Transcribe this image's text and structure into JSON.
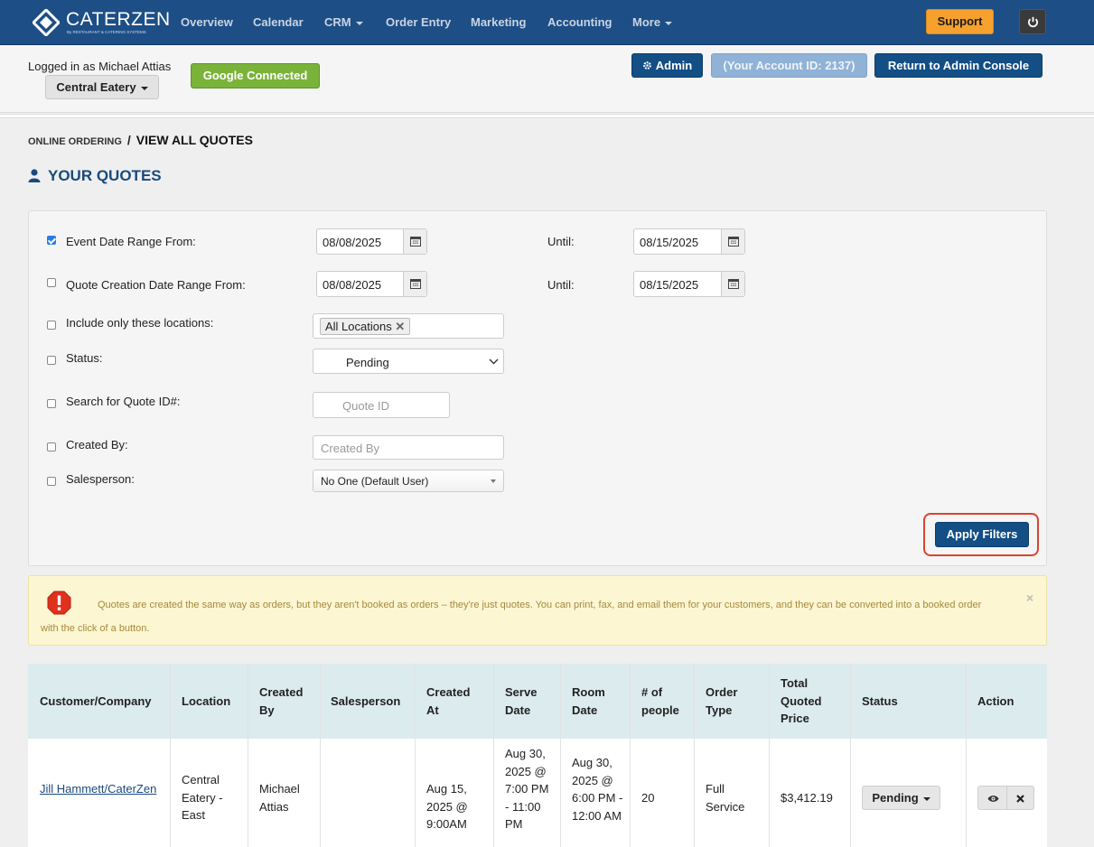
{
  "app": {
    "brand": "CATERZEN",
    "tagline": "By RESTAURANT & CATERING SYSTEMS",
    "colors": {
      "navbar": "#1d4e86",
      "support": "#f6a12e",
      "primary_button": "#134e85",
      "google": "#7bb33a",
      "alert_bg": "#fcf6d2",
      "table_header": "#dcebee"
    }
  },
  "nav": {
    "items": [
      "Overview",
      "Calendar",
      "CRM",
      "Order Entry",
      "Marketing",
      "Accounting",
      "More"
    ],
    "support_label": "Support",
    "power_icon": "power-icon"
  },
  "account": {
    "logged_in": "Logged in as Michael Attias",
    "location": "Central Eatery",
    "google": "Google Connected",
    "admin": "Admin",
    "account_id": "(Your Account ID: 2137)",
    "return": "Return to Admin Console"
  },
  "breadcrumb": {
    "parent": "ONLINE ORDERING",
    "separator": "/",
    "current": "VIEW ALL QUOTES"
  },
  "page_title": "YOUR QUOTES",
  "filters": {
    "event_date": {
      "label": "Event Date Range From:",
      "checked": true,
      "from": "08/08/2025",
      "until_label": "Until:",
      "until": "08/15/2025"
    },
    "quote_creation": {
      "label": "Quote Creation Date Range From:",
      "checked": false,
      "from": "08/08/2025",
      "until_label": "Until:",
      "until": "08/15/2025"
    },
    "locations": {
      "label": "Include only these locations:",
      "checked": false,
      "tag": "All Locations"
    },
    "status": {
      "label": "Status:",
      "checked": false,
      "value": "Pending"
    },
    "quote_id": {
      "label": "Search for Quote ID#:",
      "checked": false,
      "placeholder": "Quote ID"
    },
    "created_by": {
      "label": "Created By:",
      "checked": false,
      "placeholder": "Created By"
    },
    "salesperson": {
      "label": "Salesperson:",
      "checked": false,
      "value": "No One (Default User)"
    },
    "apply": "Apply Filters"
  },
  "alert": {
    "text": "Quotes are created the same way as orders, but they aren't booked as orders – they're just quotes. You can print, fax, and email them for your customers, and they can be converted into a booked order with the click of a button.",
    "close": "×"
  },
  "table": {
    "headers": {
      "customer": "Customer/Company",
      "location": "Location",
      "created_by": "Created By",
      "salesperson": "Salesperson",
      "created_at": "Created At",
      "serve_date": "Serve Date",
      "room_date": "Room Date",
      "people": "# of people",
      "order_type": "Order Type",
      "total": "Total Quoted Price",
      "status": "Status",
      "action": "Action"
    },
    "rows": [
      {
        "customer": "Jill Hammett/CaterZen",
        "location": "Central Eatery - East",
        "created_by": "Michael Attias",
        "salesperson": "",
        "created_at": "Aug 15, 2025 @ 9:00AM",
        "serve_date": "Aug 30, 2025 @ 7:00 PM - 11:00 PM",
        "room_date": "Aug 30, 2025 @ 6:00 PM - 12:00 AM",
        "people": "20",
        "order_type": "Full Service",
        "total": "$3,412.19",
        "status": "Pending"
      }
    ]
  }
}
